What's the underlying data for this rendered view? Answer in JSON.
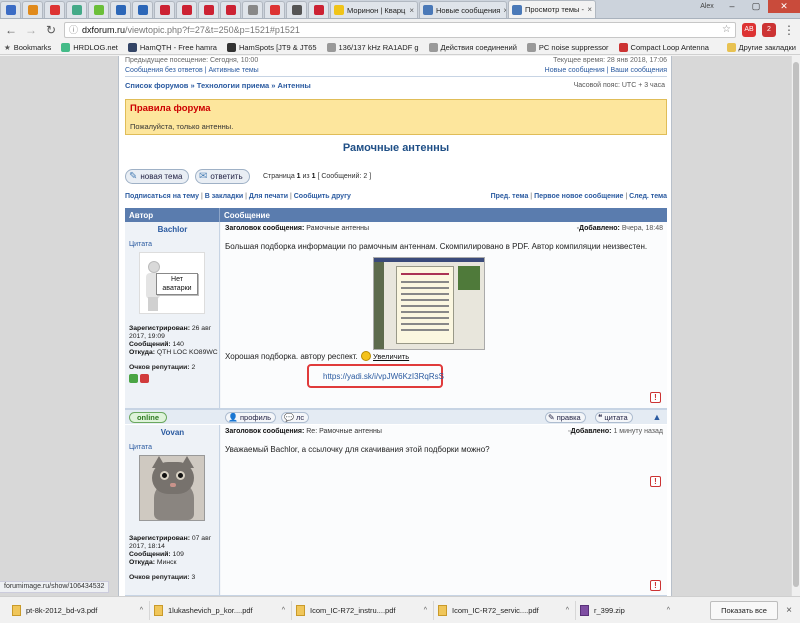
{
  "tabs": [
    {
      "title": "Моринон | Кварц",
      "icon": "yellow"
    },
    {
      "title": "Новые сообщения",
      "icon": "blue"
    },
    {
      "title": "Просмотр темы -",
      "icon": "blue"
    }
  ],
  "window": {
    "user_badge": "Alex"
  },
  "address": {
    "host": "dxforum.ru",
    "path": "/viewtopic.php?f=27&t=250&p=1521#p1521"
  },
  "bookmarks": [
    "Bookmarks",
    "HRDLOG.net",
    "HamQTH - Free hamra",
    "HamSpots [JT9 & JT65",
    "136/137 kHz RA1ADF g",
    "Действия соединений",
    "PC noise suppressor",
    "Compact Loop Antenna"
  ],
  "bookmarks_other": "Другие закладки",
  "forum": {
    "last_visit": "Предыдущее посещение: Сегодня, 10:00",
    "no_reply": "Сообщения без ответов",
    "active": "Активные темы",
    "sep": " | ",
    "now_time": "Текущее время: 28 янв 2018, 17:06",
    "new_posts": "Новые сообщения",
    "your_posts": "Ваши сообщения",
    "breadcrumb_1": "Список форумов",
    "breadcrumb_2": "Технологии приема",
    "breadcrumb_3": "Антенны",
    "bc_sep": " » ",
    "timezone": "Часовой пояс: UTC + 3 часа",
    "rules_title": "Правила форума",
    "rules_text": "Пожалуйста, только антенны.",
    "topic_title": "Рамочные антенны",
    "new_topic": "новая тема",
    "reply": "ответить",
    "page_prefix": "Страница ",
    "page_cur": "1",
    "page_of": " из ",
    "page_total": "1",
    "page_bracket_open": " [ ",
    "post_count": "Сообщений: 2",
    "page_bracket_close": " ]",
    "subscribe": "Подписаться на тему",
    "bookmark": "В закладки",
    "print": "Для печати",
    "tell": "Сообщить другу",
    "prev_topic": "Пред. тема",
    "first_new": "Первое новое сообщение",
    "next_topic": "След. тема",
    "col_author": "Автор",
    "col_message": "Сообщение"
  },
  "posts": [
    {
      "author": "Bachlor",
      "quote": "Цитата",
      "avatar_text": "Нет\nаватарки",
      "reg_label": "Зарегистрирован:",
      "reg_value": "26 авг 2017, 19:09",
      "msgs_label": "Сообщений:",
      "msgs_value": "140",
      "from_label": "Откуда:",
      "from_value": "QTH LOC KO89WC",
      "rep_label": "Очков репутации:",
      "rep_value": "2",
      "subject_label": "Заголовок сообщения:",
      "subject": "Рамочные антенны",
      "added_label": "Добавлено:",
      "added_value": "Вчера, 18:48",
      "text": "Большая подборка информации по рамочным антеннам. Скомпилировано в PDF. Автор компиляции неизвестен.",
      "text2": "Хорошая подборка. автору респект.",
      "enlarge": "Увеличить",
      "link": "https://yadi.sk/i/vpJW6KzI3RqRsS",
      "online": "online",
      "profile": "профиль",
      "pm": "лс",
      "edit": "правка",
      "quote_btn": "цитата"
    },
    {
      "author": "Vovan",
      "quote": "Цитата",
      "reg_label": "Зарегистрирован:",
      "reg_value": "07 авг 2017, 18:14",
      "msgs_label": "Сообщений:",
      "msgs_value": "109",
      "from_label": "Откуда:",
      "from_value": "Минск",
      "rep_label": "Очков репутации:",
      "rep_value": "3",
      "subject_label": "Заголовок сообщения:",
      "subject": "Re: Рамочные антенны",
      "added_label": "Добавлено:",
      "added_value": "1 минуту назад",
      "text": "Уважаемый Bachlor, а ссылочку для скачивания этой подборки можно?"
    }
  ],
  "status_url": "forumimage.ru/show/106434532",
  "downloads": [
    {
      "name": "pt-8k-2012_bd-v3.pdf",
      "type": "pdf"
    },
    {
      "name": "1lukashevich_p_kor....pdf",
      "type": "pdf"
    },
    {
      "name": "Icom_IC-R72_instru....pdf",
      "type": "pdf"
    },
    {
      "name": "Icom_IC-R72_servic....pdf",
      "type": "pdf"
    },
    {
      "name": "r_399.zip",
      "type": "zip"
    }
  ],
  "show_all": "Показать все"
}
